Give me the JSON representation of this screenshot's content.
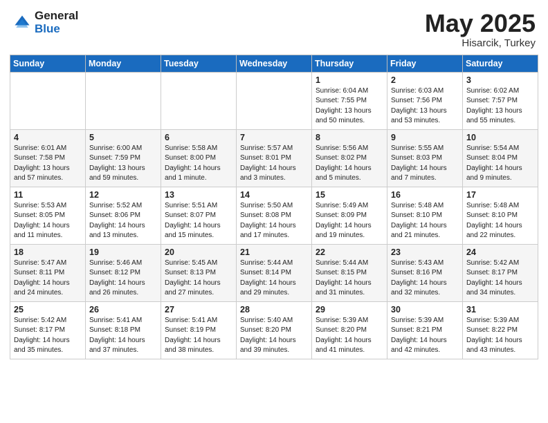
{
  "header": {
    "logo_general": "General",
    "logo_blue": "Blue",
    "title": "May 2025",
    "location": "Hisarcik, Turkey"
  },
  "days_of_week": [
    "Sunday",
    "Monday",
    "Tuesday",
    "Wednesday",
    "Thursday",
    "Friday",
    "Saturday"
  ],
  "weeks": [
    {
      "row_class": "row-white",
      "days": [
        {
          "num": "",
          "info": ""
        },
        {
          "num": "",
          "info": ""
        },
        {
          "num": "",
          "info": ""
        },
        {
          "num": "",
          "info": ""
        },
        {
          "num": "1",
          "info": "Sunrise: 6:04 AM\nSunset: 7:55 PM\nDaylight: 13 hours\nand 50 minutes."
        },
        {
          "num": "2",
          "info": "Sunrise: 6:03 AM\nSunset: 7:56 PM\nDaylight: 13 hours\nand 53 minutes."
        },
        {
          "num": "3",
          "info": "Sunrise: 6:02 AM\nSunset: 7:57 PM\nDaylight: 13 hours\nand 55 minutes."
        }
      ]
    },
    {
      "row_class": "row-gray",
      "days": [
        {
          "num": "4",
          "info": "Sunrise: 6:01 AM\nSunset: 7:58 PM\nDaylight: 13 hours\nand 57 minutes."
        },
        {
          "num": "5",
          "info": "Sunrise: 6:00 AM\nSunset: 7:59 PM\nDaylight: 13 hours\nand 59 minutes."
        },
        {
          "num": "6",
          "info": "Sunrise: 5:58 AM\nSunset: 8:00 PM\nDaylight: 14 hours\nand 1 minute."
        },
        {
          "num": "7",
          "info": "Sunrise: 5:57 AM\nSunset: 8:01 PM\nDaylight: 14 hours\nand 3 minutes."
        },
        {
          "num": "8",
          "info": "Sunrise: 5:56 AM\nSunset: 8:02 PM\nDaylight: 14 hours\nand 5 minutes."
        },
        {
          "num": "9",
          "info": "Sunrise: 5:55 AM\nSunset: 8:03 PM\nDaylight: 14 hours\nand 7 minutes."
        },
        {
          "num": "10",
          "info": "Sunrise: 5:54 AM\nSunset: 8:04 PM\nDaylight: 14 hours\nand 9 minutes."
        }
      ]
    },
    {
      "row_class": "row-white",
      "days": [
        {
          "num": "11",
          "info": "Sunrise: 5:53 AM\nSunset: 8:05 PM\nDaylight: 14 hours\nand 11 minutes."
        },
        {
          "num": "12",
          "info": "Sunrise: 5:52 AM\nSunset: 8:06 PM\nDaylight: 14 hours\nand 13 minutes."
        },
        {
          "num": "13",
          "info": "Sunrise: 5:51 AM\nSunset: 8:07 PM\nDaylight: 14 hours\nand 15 minutes."
        },
        {
          "num": "14",
          "info": "Sunrise: 5:50 AM\nSunset: 8:08 PM\nDaylight: 14 hours\nand 17 minutes."
        },
        {
          "num": "15",
          "info": "Sunrise: 5:49 AM\nSunset: 8:09 PM\nDaylight: 14 hours\nand 19 minutes."
        },
        {
          "num": "16",
          "info": "Sunrise: 5:48 AM\nSunset: 8:10 PM\nDaylight: 14 hours\nand 21 minutes."
        },
        {
          "num": "17",
          "info": "Sunrise: 5:48 AM\nSunset: 8:10 PM\nDaylight: 14 hours\nand 22 minutes."
        }
      ]
    },
    {
      "row_class": "row-gray",
      "days": [
        {
          "num": "18",
          "info": "Sunrise: 5:47 AM\nSunset: 8:11 PM\nDaylight: 14 hours\nand 24 minutes."
        },
        {
          "num": "19",
          "info": "Sunrise: 5:46 AM\nSunset: 8:12 PM\nDaylight: 14 hours\nand 26 minutes."
        },
        {
          "num": "20",
          "info": "Sunrise: 5:45 AM\nSunset: 8:13 PM\nDaylight: 14 hours\nand 27 minutes."
        },
        {
          "num": "21",
          "info": "Sunrise: 5:44 AM\nSunset: 8:14 PM\nDaylight: 14 hours\nand 29 minutes."
        },
        {
          "num": "22",
          "info": "Sunrise: 5:44 AM\nSunset: 8:15 PM\nDaylight: 14 hours\nand 31 minutes."
        },
        {
          "num": "23",
          "info": "Sunrise: 5:43 AM\nSunset: 8:16 PM\nDaylight: 14 hours\nand 32 minutes."
        },
        {
          "num": "24",
          "info": "Sunrise: 5:42 AM\nSunset: 8:17 PM\nDaylight: 14 hours\nand 34 minutes."
        }
      ]
    },
    {
      "row_class": "row-white",
      "days": [
        {
          "num": "25",
          "info": "Sunrise: 5:42 AM\nSunset: 8:17 PM\nDaylight: 14 hours\nand 35 minutes."
        },
        {
          "num": "26",
          "info": "Sunrise: 5:41 AM\nSunset: 8:18 PM\nDaylight: 14 hours\nand 37 minutes."
        },
        {
          "num": "27",
          "info": "Sunrise: 5:41 AM\nSunset: 8:19 PM\nDaylight: 14 hours\nand 38 minutes."
        },
        {
          "num": "28",
          "info": "Sunrise: 5:40 AM\nSunset: 8:20 PM\nDaylight: 14 hours\nand 39 minutes."
        },
        {
          "num": "29",
          "info": "Sunrise: 5:39 AM\nSunset: 8:20 PM\nDaylight: 14 hours\nand 41 minutes."
        },
        {
          "num": "30",
          "info": "Sunrise: 5:39 AM\nSunset: 8:21 PM\nDaylight: 14 hours\nand 42 minutes."
        },
        {
          "num": "31",
          "info": "Sunrise: 5:39 AM\nSunset: 8:22 PM\nDaylight: 14 hours\nand 43 minutes."
        }
      ]
    }
  ]
}
